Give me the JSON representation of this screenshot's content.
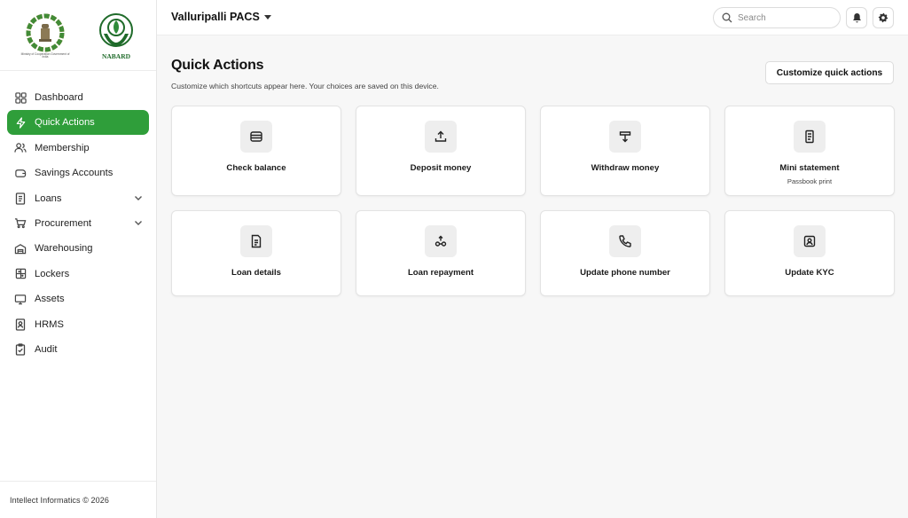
{
  "org": {
    "name": "Valluripalli PACS"
  },
  "search": {
    "placeholder": "Search"
  },
  "logos": {
    "left_caption": "Ministry of Cooperation Government of India",
    "right_caption": "NABARD"
  },
  "sidebar": {
    "items": [
      {
        "label": "Dashboard",
        "icon": "grid-icon",
        "active": false,
        "expandable": false
      },
      {
        "label": "Quick Actions",
        "icon": "bolt-icon",
        "active": true,
        "expandable": false
      },
      {
        "label": "Membership",
        "icon": "users-icon",
        "active": false,
        "expandable": false
      },
      {
        "label": "Savings Accounts",
        "icon": "piggy-bank-icon",
        "active": false,
        "expandable": false
      },
      {
        "label": "Loans",
        "icon": "document-icon",
        "active": false,
        "expandable": true
      },
      {
        "label": "Procurement",
        "icon": "cart-icon",
        "active": false,
        "expandable": true
      },
      {
        "label": "Warehousing",
        "icon": "warehouse-icon",
        "active": false,
        "expandable": false
      },
      {
        "label": "Lockers",
        "icon": "locker-icon",
        "active": false,
        "expandable": false
      },
      {
        "label": "Assets",
        "icon": "monitor-icon",
        "active": false,
        "expandable": false
      },
      {
        "label": "HRMS",
        "icon": "id-badge-icon",
        "active": false,
        "expandable": false
      },
      {
        "label": "Audit",
        "icon": "clipboard-check-icon",
        "active": false,
        "expandable": false
      }
    ]
  },
  "footer": {
    "text": "Intellect Informatics © 2026"
  },
  "main": {
    "title": "Quick Actions",
    "subtitle": "Customize which shortcuts appear here. Your choices are saved on this device.",
    "customize_label": "Customize quick actions",
    "actions": [
      {
        "label": "Check balance",
        "sub": "",
        "icon": "wallet-icon"
      },
      {
        "label": "Deposit money",
        "sub": "",
        "icon": "upload-tray-icon"
      },
      {
        "label": "Withdraw money",
        "sub": "",
        "icon": "withdraw-icon"
      },
      {
        "label": "Mini statement",
        "sub": "Passbook print",
        "icon": "receipt-icon"
      },
      {
        "label": "Loan details",
        "sub": "",
        "icon": "file-text-icon"
      },
      {
        "label": "Loan repayment",
        "sub": "",
        "icon": "repayment-icon"
      },
      {
        "label": "Update phone number",
        "sub": "",
        "icon": "phone-icon"
      },
      {
        "label": "Update KYC",
        "sub": "",
        "icon": "id-card-icon"
      }
    ]
  },
  "colors": {
    "accent": "#2f9e3a",
    "background": "#f7f7f7",
    "card": "#ffffff",
    "icon_bg": "#eeeeee"
  }
}
